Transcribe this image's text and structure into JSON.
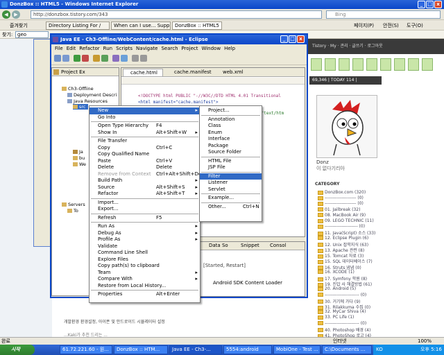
{
  "ie": {
    "title": "DonzBox :: HTML5 - Windows Internet Explorer",
    "address": "http://donzbox.tistory.com/343",
    "search_placeholder": "Bing",
    "tabs": [
      "Directory Listing For /",
      "When can I use... Supp...",
      "DonzBox :: HTML5"
    ],
    "favorites_label": "즐겨찾기",
    "toolbar_right": [
      "페이지(P)",
      "안전(S)",
      "도구(O)"
    ],
    "links_label": "찾기:",
    "links_value": "geo",
    "status": "완료",
    "zone": "인터넷",
    "zoom": "100%"
  },
  "blog": {
    "topbar": "Tistory · My ·  관리 · 글쓰기 · 로그아웃",
    "stats": "69,346 | TODAY 114 | YESTERDAY 153",
    "profile_name": "Donz",
    "profile_desc": "이 없다기리아",
    "category_header": "CATEGORY",
    "categories": [
      "DonzBox.com (320)",
      "--------------------- (0)",
      "--------------------- (0)",
      "01. Jailbreak (32)",
      "08. MacBook Air (9)",
      "09. LEGO TECHNIC (11)",
      "---------------------- (0)",
      "11. Java(Script) 소스 (33)",
      "12. Eclipse Plugin (6)",
      "12. Unix 잡학지식 (63)",
      "13. Apache 관련 (8)",
      "15. Tomcat 자료 (3)",
      "15. SQL 데이터베이스 (7)",
      "16. Struts 냄냄 (0)",
      "16. XCODE (1)",
      "17. Symfony 학원 (8)",
      "19. 진압 사 해결방법 (61)",
      "20. Android (5)",
      "----------------------- (0)",
      "30. 거기에 가다 (9)",
      "31. Rilakkuma 수집 (0)",
      "32. MyCar Shiva (4)",
      "33. PC Life (1)",
      "----------------------- (0)",
      "40. Photoshop 배경 (4)",
      "41. PhotoShop 로고 (4)"
    ],
    "bottom_text_1": "개발환경 환경설정, 아이폰 및 안드로이드 시뮬레이터 설정",
    "bottom_text_2": "...Kaki가 추천 드리는 ..."
  },
  "taskbar": {
    "start": "시작",
    "tasks": [
      "61.72.221.60 - 원...",
      "DonzBox :: HTM...",
      "Java EE - Ch3-...",
      "5554:android",
      "MobiOne - Test ...",
      "C:\\Documents ..."
    ],
    "tray_lang": "KO",
    "clock": "오후 5:16"
  },
  "eclipse": {
    "title": "Java EE - Ch3-Offline/WebContent/cache.html - Eclipse",
    "menu": [
      "File",
      "Edit",
      "Refactor",
      "Run",
      "Scripts",
      "Navigate",
      "Search",
      "Project",
      "Window",
      "Help"
    ],
    "project_explorer_title": "Project Ex",
    "editor_tabs": [
      "cache.html",
      "cache.manifest",
      "web.xml"
    ],
    "tree": [
      "Ch3-Offline",
      "Deployment Descri",
      "Java Resources",
      "src",
      "Ja",
      "bu",
      "We",
      "Servers",
      "To"
    ],
    "code": [
      "<!DOCTYPE html PUBLIC \"-//W3C//DTD HTML 4.01 Transitional",
      "<html manifest=\"cache.manifest\">",
      "=\"text/htm"
    ],
    "bottom_tabs": [
      "Data So",
      "Snippet",
      "Consol"
    ],
    "server_status": "[Started, Restart]",
    "sdk_loader": "Android SDK Content Loader"
  },
  "context_menu": [
    {
      "label": "New",
      "accel": "",
      "submenu": true,
      "selected": true
    },
    {
      "label": "Go Into",
      "accel": ""
    },
    {
      "sep": true
    },
    {
      "label": "Open Type Hierarchy",
      "accel": "F4"
    },
    {
      "label": "Show In",
      "accel": "Alt+Shift+W",
      "submenu": true
    },
    {
      "sep": true
    },
    {
      "label": "File Transfer",
      "accel": ""
    },
    {
      "label": "Copy",
      "accel": "Ctrl+C"
    },
    {
      "label": "Copy Qualified Name",
      "accel": ""
    },
    {
      "label": "Paste",
      "accel": "Ctrl+V"
    },
    {
      "label": "Delete",
      "accel": "Delete"
    },
    {
      "label": "Remove from Context",
      "accel": "Ctrl+Alt+Shift+Down",
      "disabled": true
    },
    {
      "label": "Build Path",
      "accel": "",
      "submenu": true
    },
    {
      "label": "Source",
      "accel": "Alt+Shift+S",
      "submenu": true
    },
    {
      "label": "Refactor",
      "accel": "Alt+Shift+T",
      "submenu": true
    },
    {
      "sep": true
    },
    {
      "label": "Import...",
      "accel": ""
    },
    {
      "label": "Export...",
      "accel": ""
    },
    {
      "sep": true
    },
    {
      "label": "Refresh",
      "accel": "F5"
    },
    {
      "sep": true
    },
    {
      "label": "Run As",
      "accel": "",
      "submenu": true
    },
    {
      "label": "Debug As",
      "accel": "",
      "submenu": true
    },
    {
      "label": "Profile As",
      "accel": "",
      "submenu": true
    },
    {
      "label": "Validate",
      "accel": ""
    },
    {
      "label": "Command Line Shell",
      "accel": ""
    },
    {
      "label": "Explore Files",
      "accel": ""
    },
    {
      "label": "Copy path(s) to clipboard",
      "accel": ""
    },
    {
      "label": "Team",
      "accel": "",
      "submenu": true
    },
    {
      "label": "Compare With",
      "accel": "",
      "submenu": true
    },
    {
      "label": "Restore from Local History...",
      "accel": ""
    },
    {
      "sep": true
    },
    {
      "label": "Properties",
      "accel": "Alt+Enter"
    }
  ],
  "submenu": [
    {
      "label": "Project...",
      "accel": ""
    },
    {
      "sep": true
    },
    {
      "label": "Annotation",
      "accel": ""
    },
    {
      "label": "Class",
      "accel": ""
    },
    {
      "label": "Enum",
      "accel": ""
    },
    {
      "label": "Interface",
      "accel": ""
    },
    {
      "label": "Package",
      "accel": ""
    },
    {
      "label": "Source Folder",
      "accel": ""
    },
    {
      "sep": true
    },
    {
      "label": "HTML File",
      "accel": ""
    },
    {
      "label": "JSP File",
      "accel": ""
    },
    {
      "sep": true
    },
    {
      "label": "Filter",
      "accel": "",
      "selected": true
    },
    {
      "label": "Listener",
      "accel": ""
    },
    {
      "label": "Servlet",
      "accel": ""
    },
    {
      "sep": true
    },
    {
      "label": "Example...",
      "accel": ""
    },
    {
      "sep": true
    },
    {
      "label": "Other...",
      "accel": "Ctrl+N"
    }
  ]
}
